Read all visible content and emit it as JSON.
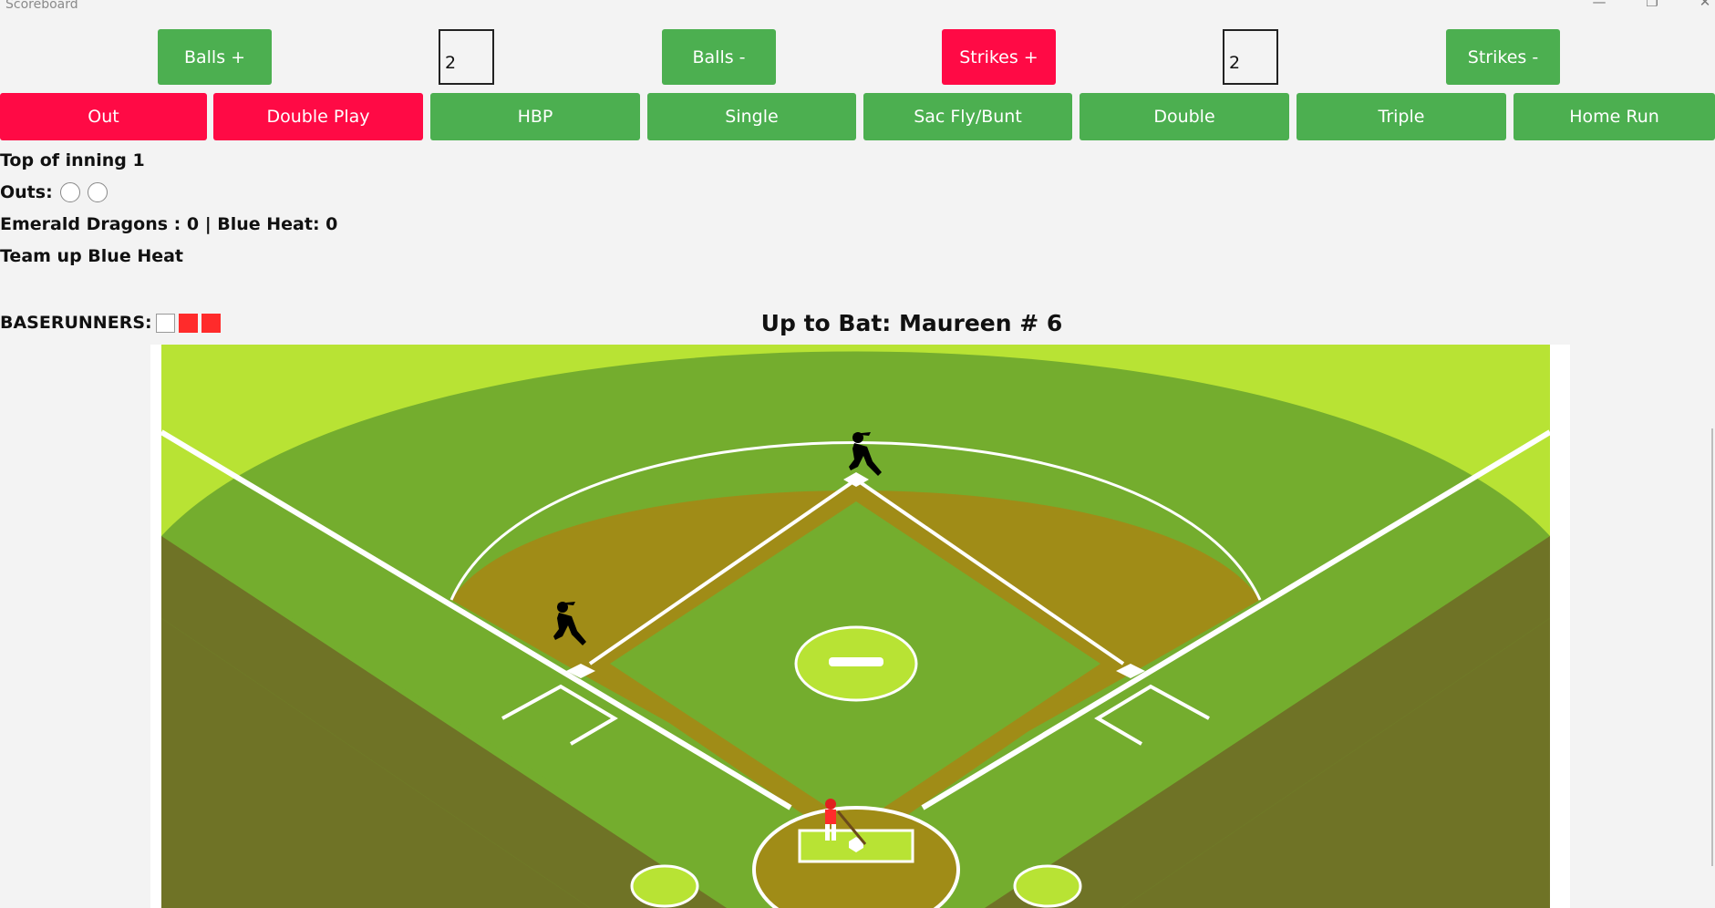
{
  "window": {
    "title": "Scoreboard",
    "minimize_icon": "—",
    "maximize_icon": "❐",
    "close_icon": "✕"
  },
  "colors": {
    "green": "#4caf50",
    "red": "#ff0a45",
    "runner_on_base": "#ff2b2b"
  },
  "count": {
    "balls_plus": "Balls +",
    "balls_value": "2",
    "balls_minus": "Balls -",
    "strikes_plus": "Strikes +",
    "strikes_value": "2",
    "strikes_minus": "Strikes -"
  },
  "plays": {
    "out": "Out",
    "double_play": "Double Play",
    "hbp": "HBP",
    "single": "Single",
    "sac_fly_bunt": "Sac Fly/Bunt",
    "double": "Double",
    "triple": "Triple",
    "home_run": "Home Run"
  },
  "status": {
    "inning": "Top of inning 1",
    "outs_label": "Outs:",
    "outs_filled": 0,
    "score": "Emerald Dragons : 0 | Blue Heat: 0",
    "team_up": "Team up Blue Heat",
    "baserunners_label": "BASERUNNERS:",
    "bases": [
      {
        "base": "first",
        "occupied": false
      },
      {
        "base": "second",
        "occupied": true
      },
      {
        "base": "third",
        "occupied": true
      }
    ]
  },
  "up_to_bat": "Up to Bat: Maureen # 6"
}
